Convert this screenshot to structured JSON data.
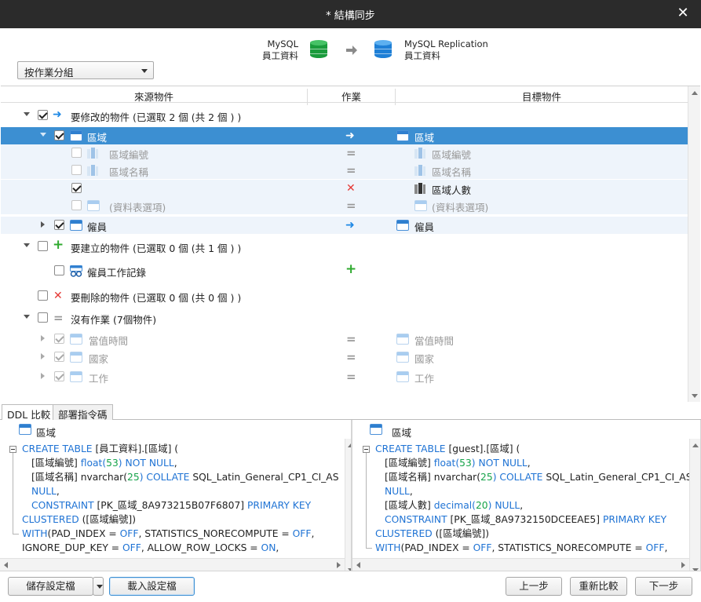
{
  "window": {
    "title": "* 結構同步"
  },
  "header": {
    "group_select": "按作業分組",
    "source": {
      "type": "MySQL",
      "db": "員工資料",
      "color": "#1a9b3c"
    },
    "target": {
      "type": "MySQL Replication",
      "db": "員工資料",
      "color": "#1e7fd6"
    }
  },
  "tree": {
    "columns": [
      "來源物件",
      "作業",
      "目標物件"
    ],
    "rows": [
      {
        "label": "要修改的物件 (已選取 2 個 (共 2 個 ) )"
      },
      {
        "label": "區域",
        "target": "區域"
      },
      {
        "label": "區域編號",
        "target": "區域編號"
      },
      {
        "label": "區域名稱",
        "target": "區域名稱"
      },
      {
        "label": "",
        "target": "區域人數"
      },
      {
        "label": "(資料表選項)",
        "target": "(資料表選項)"
      },
      {
        "label": "僱員",
        "target": "僱員"
      },
      {
        "label": "要建立的物件 (已選取 0 個 (共 1 個 ) )"
      },
      {
        "label": "僱員工作記錄"
      },
      {
        "label": "要刪除的物件 (已選取 0 個 (共 0 個 ) )"
      },
      {
        "label": "沒有作業 (7個物件)"
      },
      {
        "label": "當值時間",
        "target": "當值時間"
      },
      {
        "label": "國家",
        "target": "國家"
      },
      {
        "label": "工作",
        "target": "工作"
      }
    ]
  },
  "tabs": [
    "DDL 比較",
    "部署指令碼"
  ],
  "ddl": {
    "left_title": "區域",
    "right_title": "區域",
    "left": [
      [
        "CREATE TABLE",
        " [員工資料].[區域] ("
      ],
      [
        "",
        "[區域編號] ",
        "float(",
        "53",
        ")",
        "  NOT NULL",
        ","
      ],
      [
        "",
        "[區域名稱] nvarchar(",
        "25",
        ")",
        "  COLLATE",
        " SQL_Latin_General_CP1_CI_AS"
      ],
      [
        "NULL",
        ","
      ],
      [
        "CONSTRAINT",
        " [PK_區域_8A973215B07F6807]  ",
        "PRIMARY KEY"
      ],
      [
        "CLUSTERED",
        " ([區域編號])"
      ],
      [
        "WITH",
        "(PAD_INDEX = ",
        "OFF",
        ", STATISTICS_NORECOMPUTE = ",
        "OFF",
        ","
      ],
      [
        "",
        "IGNORE_DUP_KEY = ",
        "OFF",
        ", ALLOW_ROW_LOCKS = ",
        "ON",
        ","
      ]
    ],
    "right": [
      [
        "CREATE TABLE",
        " [guest].[區域] ("
      ],
      [
        "",
        "[區域編號] ",
        "float(",
        "53",
        ")",
        "  NOT NULL",
        ","
      ],
      [
        "",
        "[區域名稱] nvarchar(",
        "25",
        ")",
        "  COLLATE",
        " SQL_Latin_General_CP1_CI_AS"
      ],
      [
        "NULL",
        ","
      ],
      [
        "",
        "[區域人數] ",
        "decimal(",
        "20",
        ")",
        "  NULL",
        ","
      ],
      [
        "CONSTRAINT",
        " [PK_區域_8A9732150DCEEAE5]  ",
        "PRIMARY KEY"
      ],
      [
        "CLUSTERED",
        " ([區域編號])"
      ],
      [
        "WITH",
        "(PAD_INDEX = ",
        "OFF",
        ", STATISTICS_NORECOMPUTE = ",
        "OFF",
        ","
      ]
    ]
  },
  "footer": {
    "save_profile": "儲存設定檔",
    "load_profile": "載入設定檔",
    "back": "上一步",
    "recompare": "重新比較",
    "next": "下一步"
  }
}
